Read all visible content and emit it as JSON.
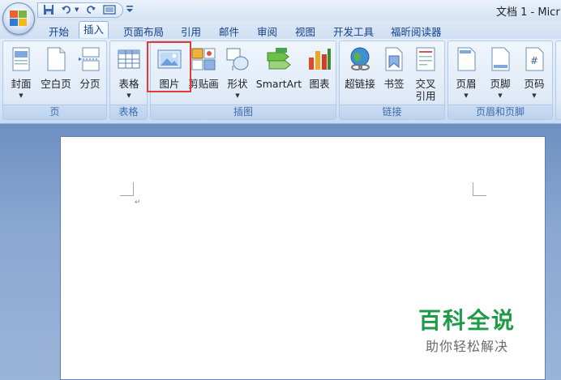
{
  "window": {
    "title": "文档 1 - Micr"
  },
  "quick_access": {
    "save_icon": "save-icon",
    "undo_icon": "undo-icon",
    "redo_icon": "redo-icon",
    "print_icon": "print-preview-icon",
    "more": "▼"
  },
  "tabs": [
    {
      "label": "开始",
      "active": false
    },
    {
      "label": "插入",
      "active": true
    },
    {
      "label": "页面布局",
      "active": false
    },
    {
      "label": "引用",
      "active": false
    },
    {
      "label": "邮件",
      "active": false
    },
    {
      "label": "审阅",
      "active": false
    },
    {
      "label": "视图",
      "active": false
    },
    {
      "label": "开发工具",
      "active": false
    },
    {
      "label": "福昕阅读器",
      "active": false
    }
  ],
  "groups": {
    "page": {
      "label": "页",
      "buttons": [
        "封面",
        "空白页",
        "分页"
      ]
    },
    "table": {
      "label": "表格",
      "buttons": [
        "表格"
      ]
    },
    "illustrations": {
      "label": "插图",
      "buttons": [
        "图片",
        "剪贴画",
        "形状",
        "SmartArt",
        "图表"
      ]
    },
    "links": {
      "label": "链接",
      "buttons": [
        "超链接",
        "书签",
        "交叉\n引用"
      ]
    },
    "header_footer": {
      "label": "页眉和页脚",
      "buttons": [
        "页眉",
        "页脚",
        "页码"
      ]
    }
  },
  "dropdown_arrow": "▼",
  "highlighted_button": "图片",
  "document": {
    "paragraph_mark": "↵"
  },
  "watermark": {
    "title": "百科全说",
    "subtitle": "助你轻松解决"
  },
  "colors": {
    "accent": "#15428b",
    "highlight": "#e03a3a",
    "watermark_green": "#1f9a48"
  }
}
